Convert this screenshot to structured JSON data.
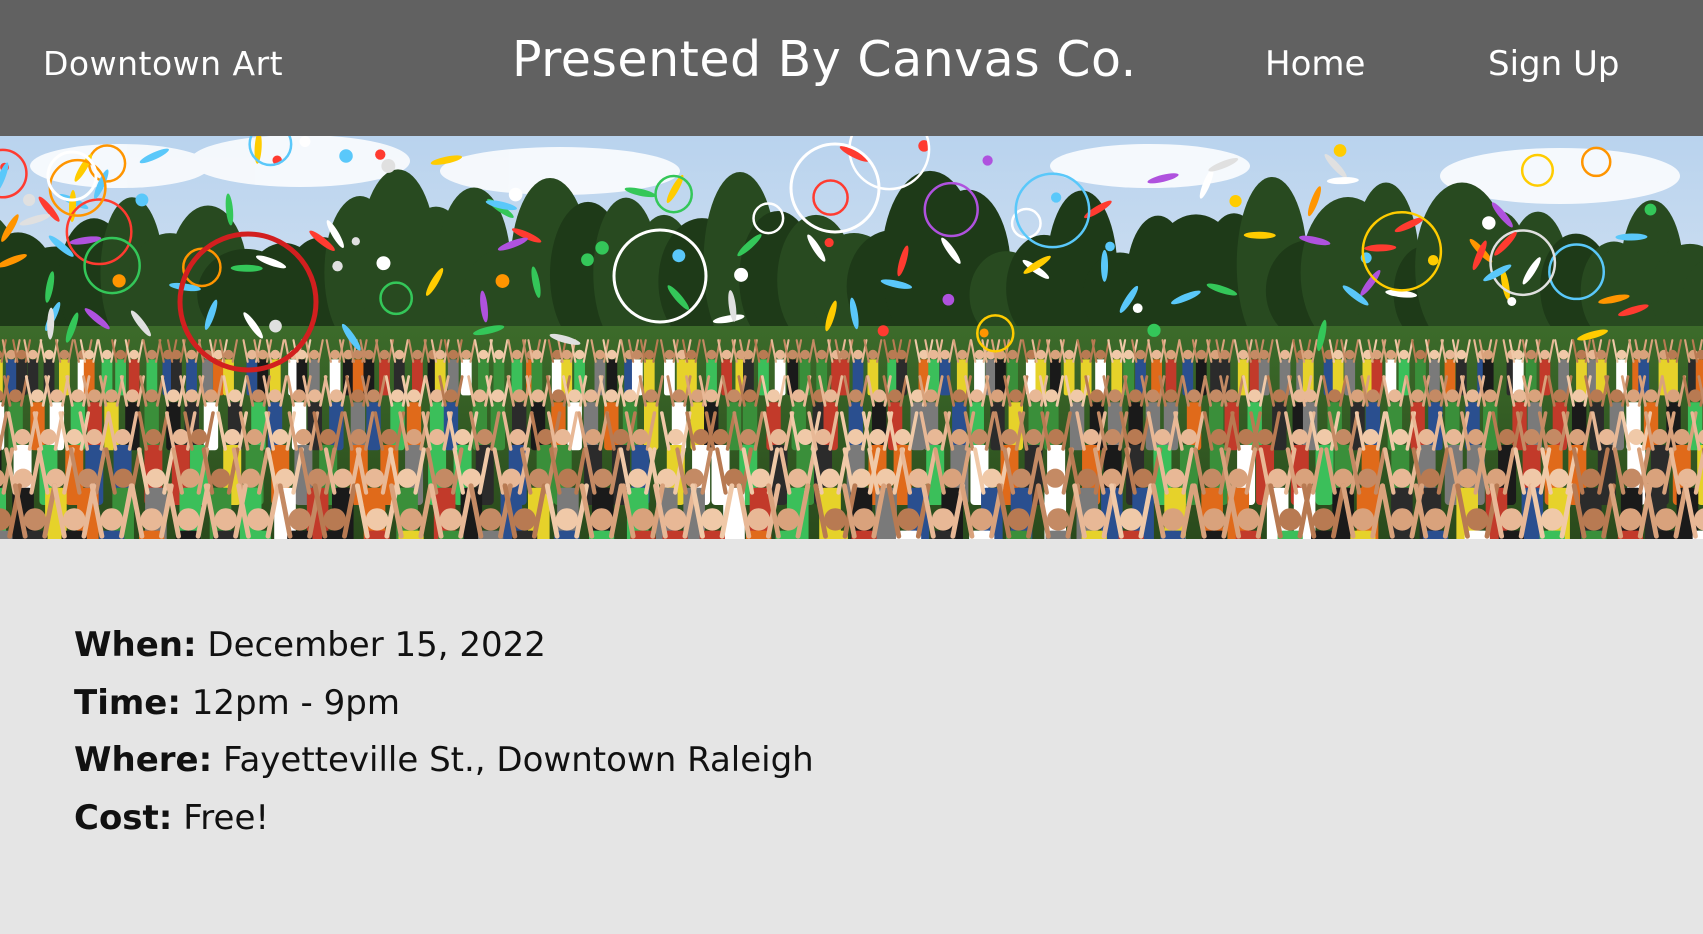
{
  "header": {
    "brand": "Downtown Art",
    "presenter": "Presented By Canvas Co.",
    "nav": [
      {
        "label": "Home"
      },
      {
        "label": "Sign Up"
      }
    ],
    "background_color": "#616161",
    "text_color": "#ffffff"
  },
  "hero": {
    "image_description_icon": "crowd-juggling-photo"
  },
  "details": {
    "when": {
      "label": "When:",
      "value": "December 15, 2022"
    },
    "time": {
      "label": "Time:",
      "value": "12pm - 9pm"
    },
    "where": {
      "label": "Where:",
      "value": "Fayetteville St., Downtown Raleigh"
    },
    "cost": {
      "label": "Cost:",
      "value": "Free!"
    }
  },
  "page_background": "#e5e5e5"
}
